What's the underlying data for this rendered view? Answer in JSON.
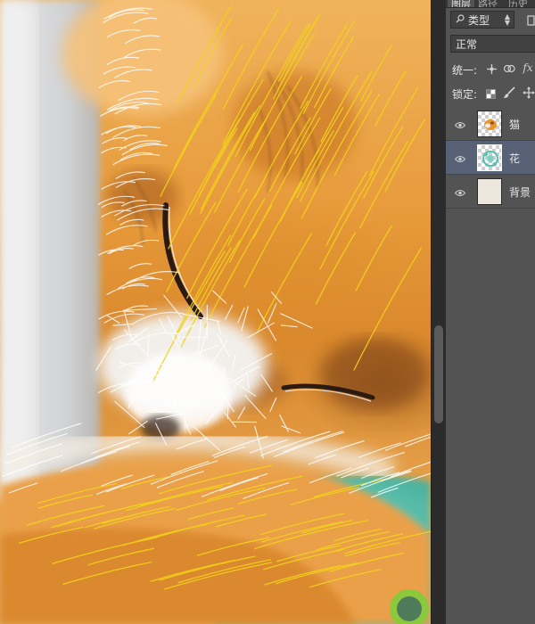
{
  "panel": {
    "tabs": [
      {
        "label": "图层",
        "active": true
      },
      {
        "label": "路径",
        "active": false
      },
      {
        "label": "历史",
        "active": false
      }
    ],
    "filter": {
      "label": "类型"
    },
    "blend_mode": {
      "value": "正常"
    },
    "unify": {
      "label": "统一:"
    },
    "lock": {
      "label": "锁定:"
    },
    "layers": [
      {
        "name": "猫",
        "visible": true,
        "selected": false,
        "thumb": "cat"
      },
      {
        "name": "花",
        "visible": true,
        "selected": true,
        "thumb": "flower"
      },
      {
        "name": "背景",
        "visible": true,
        "selected": false,
        "thumb": "solid"
      }
    ]
  },
  "colors": {
    "panel_bg": "#535353",
    "selected_layer": "#576276",
    "fur_orange": "#e08f30",
    "fur_white": "#f2efea",
    "highlight_yellow": "#f2d21a",
    "accent_green": "#8bc83b",
    "background_thumb": "#ece6dd"
  }
}
